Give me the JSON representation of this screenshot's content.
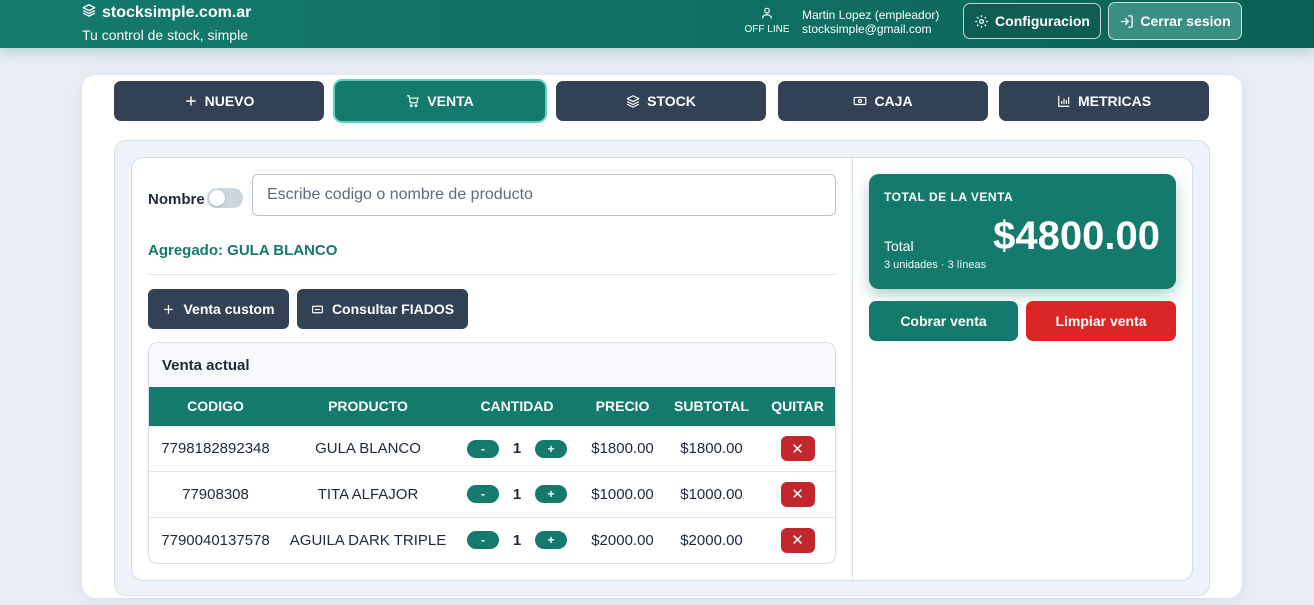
{
  "header": {
    "brand": "stocksimple.com.ar",
    "tagline": "Tu control de stock, simple",
    "status": "OFF LINE",
    "user_name": "Martin Lopez (empleador)",
    "user_email": "stocksimple@gmail.com",
    "config_label": "Configuracion",
    "logout_label": "Cerrar sesion"
  },
  "tabs": [
    {
      "label": "NUEVO",
      "icon": "plus-icon"
    },
    {
      "label": "VENTA",
      "icon": "cart-icon",
      "active": true
    },
    {
      "label": "STOCK",
      "icon": "layers-icon"
    },
    {
      "label": "CAJA",
      "icon": "cash-icon"
    },
    {
      "label": "METRICAS",
      "icon": "bar-chart-icon"
    }
  ],
  "search": {
    "toggle_label": "Nombre",
    "placeholder": "Escribe codigo o nombre de producto",
    "value": ""
  },
  "added_message": "Agregado: GULA BLANCO",
  "actions": {
    "custom_label": "Venta custom",
    "fiados_label": "Consultar FIADOS"
  },
  "sale": {
    "title": "Venta actual",
    "columns": [
      "CODIGO",
      "PRODUCTO",
      "CANTIDAD",
      "PRECIO",
      "SUBTOTAL",
      "QUITAR"
    ],
    "rows": [
      {
        "code": "7798182892348",
        "product": "GULA BLANCO",
        "qty": "1",
        "price": "$1800.00",
        "subtotal": "$1800.00"
      },
      {
        "code": "77908308",
        "product": "TITA ALFAJOR",
        "qty": "1",
        "price": "$1000.00",
        "subtotal": "$1000.00"
      },
      {
        "code": "7790040137578",
        "product": "AGUILA DARK TRIPLE",
        "qty": "1",
        "price": "$2000.00",
        "subtotal": "$2000.00"
      }
    ],
    "minus": "-",
    "plus": "+",
    "remove_glyph": "✕"
  },
  "total": {
    "title": "TOTAL DE LA VENTA",
    "label": "Total",
    "amount": "$4800.00",
    "summary": "3 unidades · 3 líneas"
  },
  "payment": {
    "cobrar_label": "Cobrar venta",
    "limpiar_label": "Limpiar venta"
  },
  "colors": {
    "primary": "#147a6c",
    "dark": "#334155",
    "danger": "#dc2626"
  }
}
